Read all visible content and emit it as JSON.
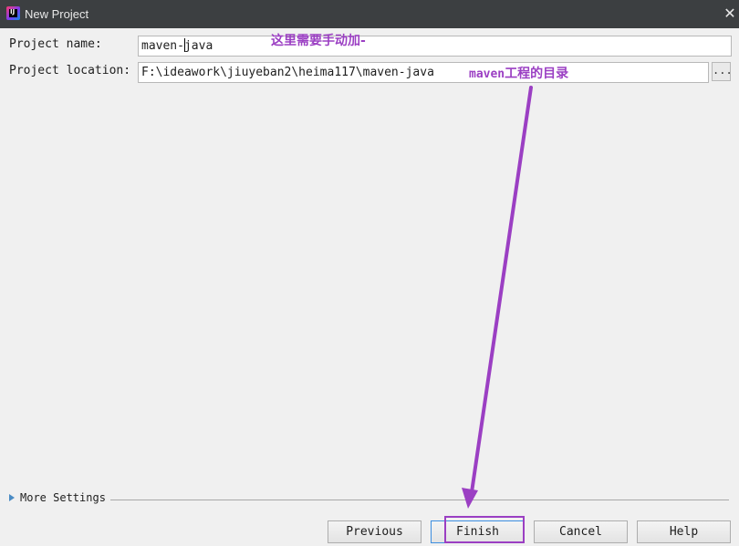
{
  "window": {
    "title": "New Project",
    "app_icon": "intellij-idea-icon",
    "close_glyph": "✕"
  },
  "form": {
    "name_label": "Project name:",
    "name_value_before_caret": "maven-",
    "name_value_after_caret": "java",
    "location_label": "Project location:",
    "location_value": "F:\\ideawork\\jiuyeban2\\heima117\\maven-java",
    "browse_label": "..."
  },
  "annotations": {
    "name_note": "这里需要手动加-",
    "location_note_prefix": "maven",
    "location_note_suffix": "工程的目录",
    "color": "#9b3fc3"
  },
  "more_settings": {
    "label": "More Settings"
  },
  "buttons": {
    "previous": "Previous",
    "finish": "Finish",
    "cancel": "Cancel",
    "help": "Help"
  }
}
